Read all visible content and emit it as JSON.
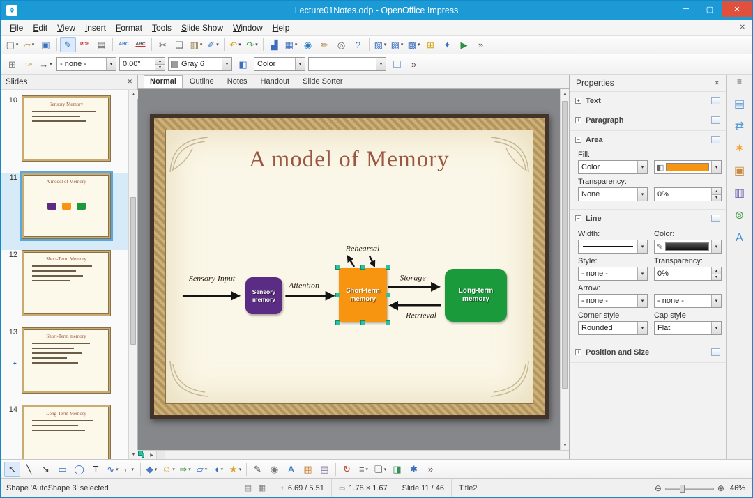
{
  "window": {
    "title": "Lecture01Notes.odp - OpenOffice Impress"
  },
  "menu_bar": {
    "items": [
      "File",
      "Edit",
      "View",
      "Insert",
      "Format",
      "Tools",
      "Slide Show",
      "Window",
      "Help"
    ]
  },
  "toolbar_standard": {
    "icons": [
      {
        "name": "new-document-icon",
        "g": "▢",
        "c": "#6b6b6b",
        "dd": true
      },
      {
        "name": "open-folder-icon",
        "g": "▱",
        "c": "#c9973f",
        "dd": true
      },
      {
        "name": "save-icon",
        "g": "▣",
        "c": "#3a6fbf"
      },
      {
        "sep": true
      },
      {
        "name": "edit-file-icon",
        "g": "✎",
        "c": "#2a6fc0",
        "pressed": true
      },
      {
        "name": "export-pdf-icon",
        "g": "PDF",
        "small": true,
        "c": "#c03030"
      },
      {
        "name": "print-icon",
        "g": "▤",
        "c": "#666"
      },
      {
        "sep": true
      },
      {
        "name": "spellcheck-icon",
        "g": "ABC",
        "small": true,
        "c": "#2a6fc0"
      },
      {
        "name": "auto-spellcheck-icon",
        "g": "ABC",
        "small": true,
        "c": "#444",
        "u": "#d03030"
      },
      {
        "sep": true
      },
      {
        "name": "cut-icon",
        "g": "✂",
        "c": "#666"
      },
      {
        "name": "copy-icon",
        "g": "❏",
        "c": "#666"
      },
      {
        "name": "paste-icon",
        "g": "▥",
        "c": "#8a6d3b",
        "dd": true
      },
      {
        "name": "format-paintbrush-icon",
        "g": "✐",
        "c": "#2a6fc0",
        "dd": true
      },
      {
        "sep": true
      },
      {
        "name": "undo-icon",
        "g": "↶",
        "c": "#d4a017",
        "dd": true
      },
      {
        "name": "redo-icon",
        "g": "↷",
        "c": "#3f9e3f",
        "dd": true
      },
      {
        "sep": true
      },
      {
        "name": "chart-icon",
        "g": "▟",
        "c": "#3a6fbf"
      },
      {
        "name": "table-icon",
        "g": "▦",
        "c": "#3a6fbf",
        "dd": true
      },
      {
        "name": "hyperlink-icon",
        "g": "◉",
        "c": "#2e7dbf"
      },
      {
        "name": "draw-functions-icon",
        "g": "✏",
        "c": "#b07a3a"
      },
      {
        "name": "zoom-icon",
        "g": "◎",
        "c": "#555"
      },
      {
        "name": "help-icon",
        "g": "?",
        "c": "#2a6fc0"
      },
      {
        "sep": true
      },
      {
        "name": "new-slide-icon",
        "g": "▧",
        "c": "#3a6fbf",
        "dd": true
      },
      {
        "name": "slide-layout-icon",
        "g": "▨",
        "c": "#3a6fbf",
        "dd": true
      },
      {
        "name": "slide-design-icon",
        "g": "▩",
        "c": "#3a6fbf",
        "dd": true
      },
      {
        "name": "grid-icon",
        "g": "⊞",
        "c": "#d4a017"
      },
      {
        "name": "navigator-icon",
        "g": "✦",
        "c": "#3a6fbf"
      },
      {
        "name": "presentation-icon",
        "g": "▶",
        "c": "#2f8f3f"
      },
      {
        "name": "toolbar-overflow-icon",
        "g": "»",
        "c": "#555"
      }
    ]
  },
  "toolbar_line": {
    "left_icons": [
      {
        "name": "styles-window-icon",
        "g": "⊞",
        "c": "#777"
      },
      {
        "name": "line-dialog-icon",
        "g": "✑",
        "c": "#c9973f"
      },
      {
        "name": "arrow-style-icon",
        "g": "→",
        "c": "#555",
        "dd": true
      }
    ],
    "line_style": "- none -",
    "line_width": "0.00\"",
    "line_color": "Gray 6",
    "mid_icons": [
      {
        "name": "area-dialog-icon",
        "g": "◧",
        "c": "#3a6fbf"
      }
    ],
    "area_style": "Color",
    "fill_value": "",
    "right_icons": [
      {
        "name": "shadow-icon",
        "g": "❏",
        "c": "#3a6fbf"
      },
      {
        "name": "toolbar-overflow-icon",
        "g": "»",
        "c": "#555"
      }
    ]
  },
  "slides_panel": {
    "header": "Slides",
    "slides": [
      {
        "number": "10",
        "title": "Sensory Memory"
      },
      {
        "number": "11",
        "title": "A model of Memory",
        "selected": true,
        "kind": "diagram"
      },
      {
        "number": "12",
        "title": "Short-Term Memory"
      },
      {
        "number": "13",
        "title": "Short-Term memory",
        "indicator": true
      },
      {
        "number": "14",
        "title": "Long-Term Memory"
      }
    ]
  },
  "view_tabs": [
    {
      "label": "Normal",
      "active": true
    },
    {
      "label": "Outline"
    },
    {
      "label": "Notes"
    },
    {
      "label": "Handout"
    },
    {
      "label": "Slide Sorter"
    }
  ],
  "slide": {
    "title": "A model of Memory",
    "boxes": {
      "sensory": "Sensory memory",
      "short_term": "Short-term memory",
      "long_term": "Long-term memory"
    },
    "labels": {
      "sensory_input": "Sensory Input",
      "attention": "Attention",
      "rehearsal": "Rehearsal",
      "storage": "Storage",
      "retrieval": "Retrieval"
    }
  },
  "properties_panel": {
    "title": "Properties",
    "sections": {
      "text": "Text",
      "paragraph": "Paragraph",
      "area": "Area",
      "line": "Line",
      "possize": "Position and Size"
    },
    "area": {
      "fill_label": "Fill:",
      "fill_type": "Color",
      "transparency_label": "Transparency:",
      "transparency_type": "None",
      "transparency_value": "0%"
    },
    "line": {
      "width_label": "Width:",
      "color_label": "Color:",
      "style_label": "Style:",
      "style_value": "- none -",
      "transparency_label": "Transparency:",
      "transparency_value": "0%",
      "arrow_label": "Arrow:",
      "arrow_begin": "- none -",
      "arrow_end": "- none -",
      "corner_label": "Corner style",
      "corner_value": "Rounded",
      "cap_label": "Cap style",
      "cap_value": "Flat"
    }
  },
  "sidebar": {
    "tabs": [
      {
        "name": "properties-tab-icon",
        "g": "▤",
        "c": "#4f92d2"
      },
      {
        "name": "slide-transition-tab-icon",
        "g": "⇄",
        "c": "#5b9bd5"
      },
      {
        "name": "custom-animation-tab-icon",
        "g": "✶",
        "c": "#f0a232"
      },
      {
        "name": "gallery-tab-icon",
        "g": "▣",
        "c": "#c98a3e"
      },
      {
        "name": "master-pages-tab-icon",
        "g": "▥",
        "c": "#7b68b5"
      },
      {
        "name": "navigator-tab-icon",
        "g": "⊚",
        "c": "#43a047"
      },
      {
        "name": "styles-tab-icon",
        "g": "A",
        "c": "#3f8fd0"
      }
    ]
  },
  "toolbar_drawing": {
    "icons": [
      {
        "name": "select-icon",
        "g": "↖",
        "c": "#333",
        "pressed": true
      },
      {
        "name": "line-icon",
        "g": "╲",
        "c": "#333"
      },
      {
        "name": "arrow-line-icon",
        "g": "↘",
        "c": "#333"
      },
      {
        "name": "rectangle-icon",
        "g": "▭",
        "c": "#3a6fbf"
      },
      {
        "name": "ellipse-icon",
        "g": "◯",
        "c": "#3a6fbf"
      },
      {
        "name": "text-icon",
        "g": "T",
        "c": "#333"
      },
      {
        "name": "curve-icon",
        "g": "∿",
        "c": "#3a6fbf",
        "dd": true
      },
      {
        "name": "connector-icon",
        "g": "⌐",
        "c": "#555",
        "dd": true
      },
      {
        "sep": true
      },
      {
        "name": "basic-shapes-icon",
        "g": "◆",
        "c": "#4a7dbf",
        "dd": true
      },
      {
        "name": "symbol-shapes-icon",
        "g": "☺",
        "c": "#d49a1f",
        "dd": true
      },
      {
        "name": "block-arrows-icon",
        "g": "⇒",
        "c": "#3f8f3f",
        "dd": true
      },
      {
        "name": "flowchart-icon",
        "g": "▱",
        "c": "#3a6fbf",
        "dd": true
      },
      {
        "name": "callouts-icon",
        "g": "◖",
        "c": "#3a6fbf",
        "dd": true
      },
      {
        "name": "stars-icon",
        "g": "★",
        "c": "#e0a52a",
        "dd": true
      },
      {
        "sep": true
      },
      {
        "name": "edit-points-icon",
        "g": "✎",
        "c": "#555"
      },
      {
        "name": "glue-points-icon",
        "g": "◉",
        "c": "#777"
      },
      {
        "name": "fontwork-icon",
        "g": "A",
        "c": "#2a6fc0"
      },
      {
        "name": "insert-picture-icon",
        "g": "▦",
        "c": "#c9823a"
      },
      {
        "name": "gallery-icon",
        "g": "▤",
        "c": "#7a6a9a"
      },
      {
        "sep": true
      },
      {
        "name": "rotate-icon",
        "g": "↻",
        "c": "#c04a3a"
      },
      {
        "name": "align-icon",
        "g": "≡",
        "c": "#555",
        "dd": true
      },
      {
        "name": "arrange-icon",
        "g": "❏",
        "c": "#555",
        "dd": true
      },
      {
        "name": "extrusion-icon",
        "g": "◨",
        "c": "#3a8f5f"
      },
      {
        "name": "interaction-icon",
        "g": "✱",
        "c": "#3a6fbf"
      },
      {
        "name": "toolbar-overflow-icon",
        "g": "»",
        "c": "#555"
      }
    ]
  },
  "status_bar": {
    "shape_status": "Shape 'AutoShape 3' selected",
    "icons": [
      {
        "name": "slide-view-icon",
        "g": "▤",
        "c": "#777"
      },
      {
        "name": "modified-status-icon",
        "g": "▦",
        "c": "#777"
      }
    ],
    "position": "6.69 / 5.51",
    "size": "1.78 × 1.67",
    "slide_indicator": "Slide 11 / 46",
    "layout_name": "Title2",
    "zoom_percent": "46%"
  },
  "colors": {
    "titlebar": "#1b9ad6",
    "slide_title_text": "#9b5742",
    "box_sensory": "#5b2c83",
    "box_short_term": "#f79410",
    "box_long_term": "#1a9a3a",
    "fill_swatch": "#f79410",
    "selection_handle": "#2fbf9f"
  }
}
